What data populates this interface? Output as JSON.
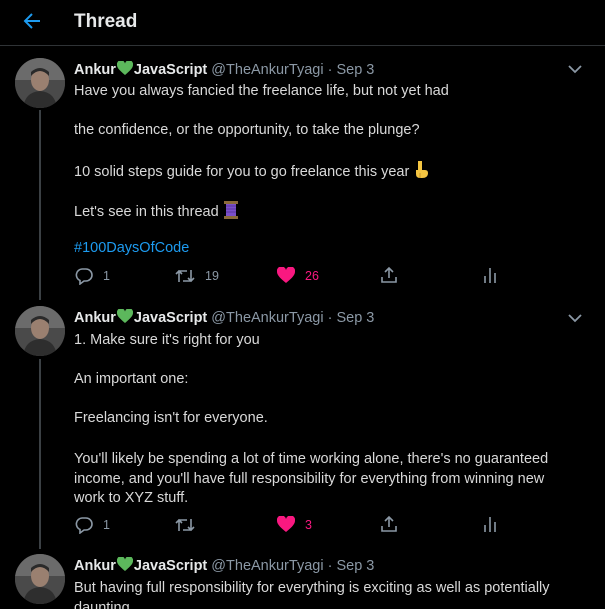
{
  "header": {
    "title": "Thread"
  },
  "tweets": [
    {
      "author": "Ankur",
      "author_suffix": "JavaScript",
      "handle": "@TheAnkurTyagi",
      "separator": "·",
      "date": "Sep 3",
      "lines": [
        "Have you always fancied the freelance life, but not yet had",
        "the confidence, or the opportunity, to take the plunge?",
        "10 solid steps guide for you to go freelance this year",
        "Let's see in this thread",
        "#100DaysOfCode"
      ],
      "replies": "1",
      "retweets": "19",
      "likes": "26"
    },
    {
      "author": "Ankur",
      "author_suffix": "JavaScript",
      "handle": "@TheAnkurTyagi",
      "separator": "·",
      "date": "Sep 3",
      "lines": [
        "1. Make sure it's right for you",
        "An important one:",
        "Freelancing isn't for everyone.",
        "You'll likely be spending a lot of time working alone, there's no guaranteed income, and you'll have full responsibility for everything from winning new work to XYZ stuff."
      ],
      "replies": "1",
      "retweets": "",
      "likes": "3"
    },
    {
      "author": "Ankur",
      "author_suffix": "JavaScript",
      "handle": "@TheAnkurTyagi",
      "separator": "·",
      "date": "Sep 3",
      "lines": [
        "But having full responsibility for everything is exciting as well as potentially daunting."
      ]
    }
  ],
  "colors": {
    "accent": "#1d9bf0",
    "like": "#f91880",
    "muted": "#8b98a5",
    "background": "#000000"
  },
  "icons": [
    "back-arrow-icon",
    "chevron-down-icon",
    "reply-icon",
    "retweet-icon",
    "like-icon",
    "share-icon",
    "analytics-icon",
    "green-heart-icon",
    "pointing-down-icon",
    "thread-spool-icon"
  ]
}
